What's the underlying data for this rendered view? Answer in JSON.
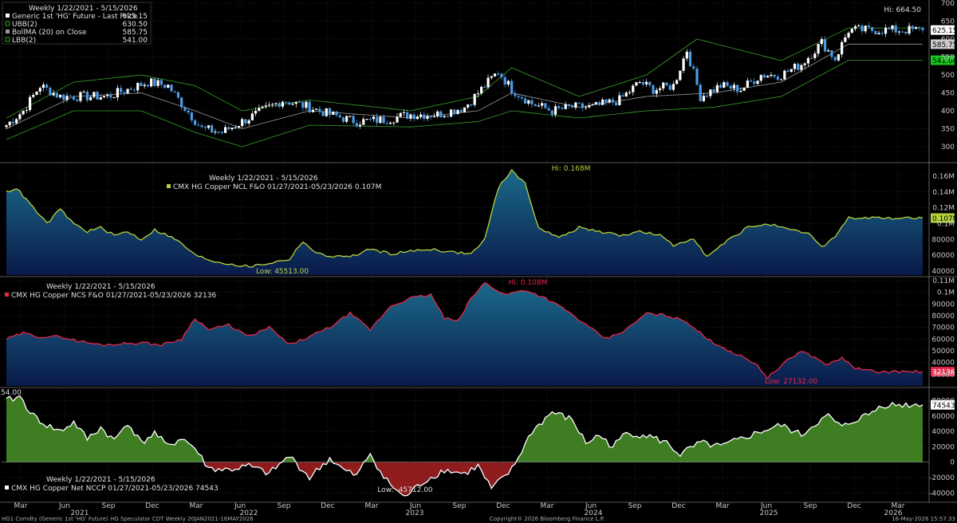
{
  "colors": {
    "background": "#000000",
    "grid": "#3a3a3a",
    "bull": "#ffffff",
    "bear": "#4a9be8",
    "upper_band": "#3aa02a",
    "lower_band": "#3aa02a",
    "ma": "#9a9a9a",
    "ncl_line": "#b4d33a",
    "ncs_line": "#e8284a",
    "fill_top": "#1a6a8a",
    "fill_bottom": "#0a1a4a",
    "net_pos": "#3e7d22",
    "net_neg": "#8e1c1c",
    "net_line": "#ffffff",
    "price_tag": "#ffffff",
    "lbb_tag": "#19c51e"
  },
  "chart_data": [
    {
      "type": "candlestick",
      "legend_header": "Weekly 1/22/2021 - 5/15/2026",
      "legend": [
        {
          "name": "Generic 1st 'HG' Future - Last Price",
          "value": "625.15"
        },
        {
          "name": "UBB(2)",
          "value": "630.50"
        },
        {
          "name": "BollMA (20)  on Close",
          "value": "585.75"
        },
        {
          "name": "LBB(2)",
          "value": "541.00"
        }
      ],
      "ylim": [
        260,
        700
      ],
      "yticks": [
        "300",
        "350",
        "400",
        "450",
        "500",
        "550",
        "600",
        "650",
        "700"
      ],
      "hi_label": "Hi: 664.50",
      "tags": [
        "625.15",
        "585.75",
        "541.00"
      ],
      "close_anchors": [
        [
          0,
          360
        ],
        [
          5,
          400
        ],
        [
          10,
          470
        ],
        [
          16,
          440
        ],
        [
          22,
          440
        ],
        [
          30,
          440
        ],
        [
          36,
          460
        ],
        [
          42,
          480
        ],
        [
          48,
          470
        ],
        [
          52,
          420
        ],
        [
          58,
          350
        ],
        [
          64,
          340
        ],
        [
          70,
          370
        ],
        [
          76,
          400
        ],
        [
          82,
          430
        ],
        [
          90,
          410
        ],
        [
          96,
          390
        ],
        [
          104,
          370
        ],
        [
          112,
          375
        ],
        [
          120,
          390
        ],
        [
          128,
          390
        ],
        [
          136,
          410
        ],
        [
          142,
          470
        ],
        [
          146,
          510
        ],
        [
          150,
          460
        ],
        [
          156,
          420
        ],
        [
          162,
          400
        ],
        [
          168,
          410
        ],
        [
          174,
          410
        ],
        [
          182,
          430
        ],
        [
          188,
          480
        ],
        [
          192,
          460
        ],
        [
          198,
          470
        ],
        [
          202,
          570
        ],
        [
          206,
          440
        ],
        [
          212,
          470
        ],
        [
          218,
          460
        ],
        [
          224,
          500
        ],
        [
          230,
          500
        ],
        [
          236,
          530
        ],
        [
          242,
          590
        ],
        [
          246,
          545
        ],
        [
          250,
          625
        ]
      ],
      "ma_anchors": [
        [
          0,
          350
        ],
        [
          20,
          440
        ],
        [
          40,
          450
        ],
        [
          56,
          400
        ],
        [
          70,
          350
        ],
        [
          90,
          400
        ],
        [
          120,
          380
        ],
        [
          140,
          400
        ],
        [
          150,
          450
        ],
        [
          170,
          410
        ],
        [
          190,
          440
        ],
        [
          210,
          450
        ],
        [
          230,
          480
        ],
        [
          250,
          586
        ]
      ],
      "ubb_anchors": [
        [
          0,
          380
        ],
        [
          20,
          480
        ],
        [
          40,
          500
        ],
        [
          56,
          470
        ],
        [
          70,
          400
        ],
        [
          90,
          430
        ],
        [
          120,
          400
        ],
        [
          140,
          440
        ],
        [
          150,
          520
        ],
        [
          170,
          440
        ],
        [
          190,
          500
        ],
        [
          205,
          600
        ],
        [
          230,
          540
        ],
        [
          250,
          631
        ]
      ],
      "lbb_anchors": [
        [
          0,
          320
        ],
        [
          20,
          400
        ],
        [
          40,
          400
        ],
        [
          56,
          340
        ],
        [
          70,
          300
        ],
        [
          90,
          360
        ],
        [
          120,
          355
        ],
        [
          140,
          370
        ],
        [
          150,
          400
        ],
        [
          170,
          380
        ],
        [
          190,
          400
        ],
        [
          210,
          410
        ],
        [
          230,
          440
        ],
        [
          250,
          541
        ]
      ]
    },
    {
      "type": "area",
      "legend_header": "Weekly 1/22/2021 - 5/15/2026",
      "series_name": "CMX HG Copper NCL F&O 01/27/2021-05/23/2026 0.107M",
      "ylim": [
        35000,
        175000
      ],
      "yticks": [
        "40000",
        "60000",
        "80000",
        "0.1M",
        "0.12M",
        "0.14M",
        "0.16M"
      ],
      "hi_label": "Hi: 0.168M",
      "low_label": "Low: 45513.00",
      "last_tag": "0.107M",
      "anchors": [
        [
          0,
          140000
        ],
        [
          3,
          145000
        ],
        [
          8,
          120000
        ],
        [
          12,
          100000
        ],
        [
          16,
          118000
        ],
        [
          20,
          100000
        ],
        [
          24,
          90000
        ],
        [
          28,
          95000
        ],
        [
          32,
          85000
        ],
        [
          36,
          90000
        ],
        [
          40,
          80000
        ],
        [
          44,
          92000
        ],
        [
          48,
          85000
        ],
        [
          52,
          75000
        ],
        [
          56,
          60000
        ],
        [
          62,
          52000
        ],
        [
          68,
          48000
        ],
        [
          72,
          45513
        ],
        [
          78,
          50000
        ],
        [
          84,
          55000
        ],
        [
          88,
          78000
        ],
        [
          92,
          62000
        ],
        [
          98,
          58000
        ],
        [
          104,
          60000
        ],
        [
          108,
          68000
        ],
        [
          114,
          62000
        ],
        [
          120,
          65000
        ],
        [
          126,
          68000
        ],
        [
          132,
          64000
        ],
        [
          138,
          62000
        ],
        [
          142,
          80000
        ],
        [
          146,
          145000
        ],
        [
          150,
          168000
        ],
        [
          154,
          150000
        ],
        [
          158,
          95000
        ],
        [
          164,
          82000
        ],
        [
          170,
          95000
        ],
        [
          176,
          90000
        ],
        [
          182,
          85000
        ],
        [
          188,
          90000
        ],
        [
          194,
          85000
        ],
        [
          198,
          72000
        ],
        [
          204,
          82000
        ],
        [
          208,
          58000
        ],
        [
          214,
          78000
        ],
        [
          220,
          95000
        ],
        [
          226,
          100000
        ],
        [
          232,
          92000
        ],
        [
          238,
          88000
        ],
        [
          242,
          70000
        ],
        [
          246,
          84000
        ],
        [
          250,
          107000
        ]
      ]
    },
    {
      "type": "area",
      "legend_header": "Weekly 1/22/2021 - 5/15/2026",
      "series_name": "CMX HG Copper NCS F&O 01/27/2021-05/23/2026 32136",
      "ylim": [
        20000,
        112000
      ],
      "yticks": [
        "30000",
        "40000",
        "50000",
        "60000",
        "70000",
        "80000",
        "90000",
        "0.1M",
        "0.11M"
      ],
      "hi_label": "Hi: 0.108M",
      "low_label": "Low: 27132.00",
      "last_tag": "32136",
      "anchors": [
        [
          0,
          60000
        ],
        [
          5,
          65000
        ],
        [
          10,
          62000
        ],
        [
          16,
          62000
        ],
        [
          22,
          58000
        ],
        [
          28,
          55000
        ],
        [
          34,
          56000
        ],
        [
          40,
          57000
        ],
        [
          46,
          55000
        ],
        [
          52,
          60000
        ],
        [
          56,
          78000
        ],
        [
          60,
          68000
        ],
        [
          66,
          72000
        ],
        [
          72,
          62000
        ],
        [
          78,
          70000
        ],
        [
          84,
          55000
        ],
        [
          90,
          62000
        ],
        [
          96,
          70000
        ],
        [
          102,
          82000
        ],
        [
          108,
          68000
        ],
        [
          114,
          88000
        ],
        [
          120,
          95000
        ],
        [
          126,
          98000
        ],
        [
          130,
          78000
        ],
        [
          134,
          75000
        ],
        [
          138,
          95000
        ],
        [
          142,
          108000
        ],
        [
          148,
          98000
        ],
        [
          154,
          102000
        ],
        [
          160,
          95000
        ],
        [
          166,
          85000
        ],
        [
          172,
          72000
        ],
        [
          178,
          60000
        ],
        [
          184,
          68000
        ],
        [
          190,
          82000
        ],
        [
          196,
          80000
        ],
        [
          202,
          75000
        ],
        [
          208,
          60000
        ],
        [
          216,
          48000
        ],
        [
          222,
          40000
        ],
        [
          226,
          27132
        ],
        [
          232,
          42000
        ],
        [
          236,
          50000
        ],
        [
          240,
          44000
        ],
        [
          244,
          38000
        ],
        [
          248,
          44000
        ],
        [
          252,
          35000
        ],
        [
          258,
          32000
        ],
        [
          264,
          32136
        ]
      ]
    },
    {
      "type": "area",
      "legend_header": "Weekly 1/22/2021 - 5/15/2026",
      "series_name": "CMX HG Copper Net NCCP 01/27/2021-05/23/2026 74543",
      "ylim": [
        -50000,
        95000
      ],
      "yticks": [
        "-40000",
        "-20000",
        "0",
        "20000",
        "40000",
        "60000",
        "80000"
      ],
      "left_label": "54.00",
      "low_label": "Low: -45712.00",
      "last_tag": "74543",
      "anchors": [
        [
          0,
          80000
        ],
        [
          4,
          85000
        ],
        [
          8,
          60000
        ],
        [
          12,
          48000
        ],
        [
          16,
          40000
        ],
        [
          20,
          52000
        ],
        [
          24,
          30000
        ],
        [
          28,
          45000
        ],
        [
          32,
          28000
        ],
        [
          36,
          52000
        ],
        [
          40,
          25000
        ],
        [
          44,
          38000
        ],
        [
          48,
          20000
        ],
        [
          52,
          32000
        ],
        [
          56,
          18000
        ],
        [
          60,
          -8000
        ],
        [
          66,
          -10000
        ],
        [
          72,
          -5000
        ],
        [
          78,
          -15000
        ],
        [
          84,
          8000
        ],
        [
          90,
          -20000
        ],
        [
          96,
          5000
        ],
        [
          100,
          -10000
        ],
        [
          104,
          -18000
        ],
        [
          108,
          12000
        ],
        [
          112,
          -20000
        ],
        [
          118,
          -45712
        ],
        [
          124,
          -25000
        ],
        [
          130,
          -10000
        ],
        [
          136,
          -15000
        ],
        [
          140,
          -5000
        ],
        [
          144,
          -35000
        ],
        [
          150,
          -10000
        ],
        [
          156,
          40000
        ],
        [
          162,
          65000
        ],
        [
          168,
          55000
        ],
        [
          172,
          25000
        ],
        [
          176,
          35000
        ],
        [
          180,
          20000
        ],
        [
          184,
          38000
        ],
        [
          190,
          35000
        ],
        [
          196,
          25000
        ],
        [
          200,
          10000
        ],
        [
          206,
          25000
        ],
        [
          212,
          20000
        ],
        [
          218,
          30000
        ],
        [
          224,
          40000
        ],
        [
          230,
          48000
        ],
        [
          236,
          35000
        ],
        [
          240,
          50000
        ],
        [
          244,
          60000
        ],
        [
          248,
          45000
        ],
        [
          252,
          55000
        ],
        [
          256,
          62000
        ],
        [
          260,
          74543
        ]
      ]
    }
  ],
  "x_axis": {
    "month_labels": [
      "Mar",
      "Jun",
      "Sep",
      "Dec",
      "Mar",
      "Jun",
      "Sep",
      "Dec",
      "Mar",
      "Jun",
      "Sep",
      "Dec",
      "Mar",
      "Jun",
      "Sep",
      "Dec",
      "Mar",
      "Jun",
      "Sep",
      "Dec",
      "Mar"
    ],
    "year_labels": [
      "2021",
      "2022",
      "2023",
      "2024",
      "2025",
      "2026"
    ]
  },
  "footer": {
    "left": "HG1 Comdty (Generic 1st 'HG' Future) HG Speculator CDT Weekly 20JAN2021-16MAY2026",
    "center": "Copyright® 2026 Bloomberg Finance L.P.",
    "right": "16-May-2026 15:57:33"
  }
}
